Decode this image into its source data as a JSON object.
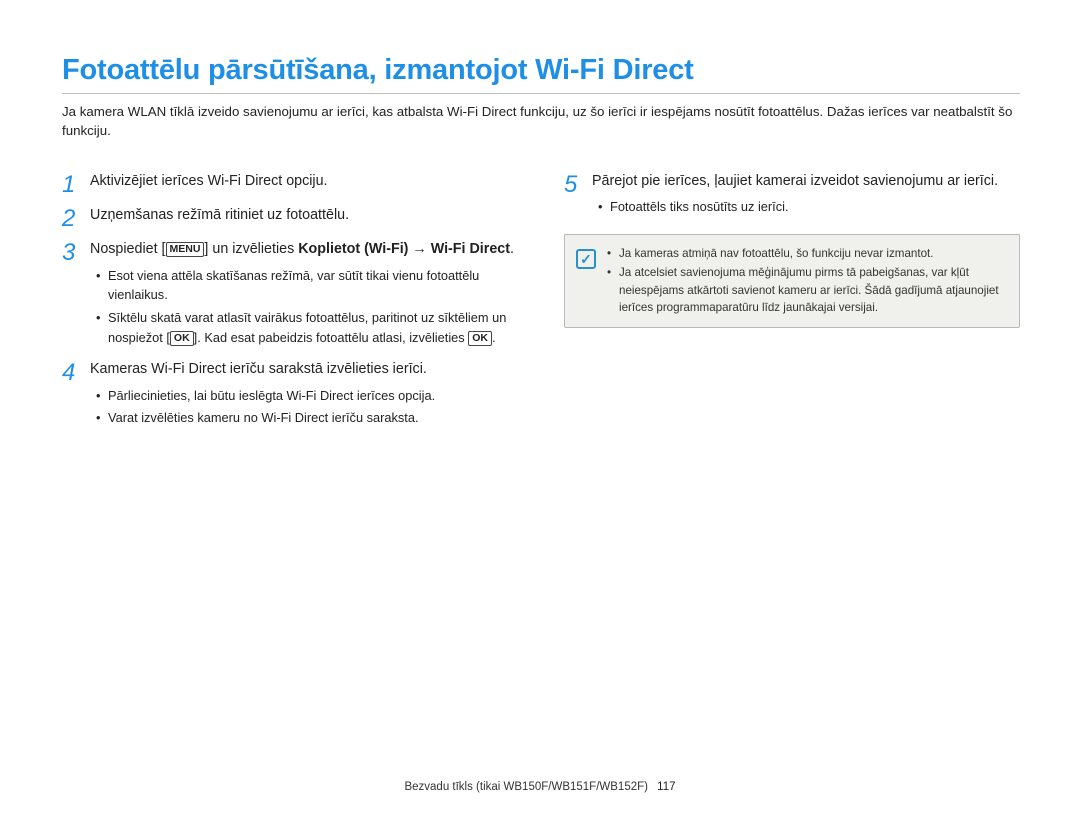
{
  "title": "Fotoattēlu pārsūtīšana, izmantojot Wi-Fi Direct",
  "intro": "Ja kamera WLAN tīklā izveido savienojumu ar ierīci, kas atbalsta Wi-Fi Direct funkciju, uz šo ierīci ir iespējams nosūtīt fotoattēlus. Dažas ierīces var neatbalstīt šo funkciju.",
  "steps": {
    "s1": {
      "num": "1",
      "text": "Aktivizējiet ierīces Wi-Fi Direct opciju."
    },
    "s2": {
      "num": "2",
      "text": "Uzņemšanas režīmā ritiniet uz fotoattēlu."
    },
    "s3": {
      "num": "3",
      "pre": "Nospiediet [",
      "menu": "MENU",
      "mid": "] un izvēlieties ",
      "bold1": "Koplietot (Wi-Fi)",
      "arrow": " → ",
      "bold2": "Wi-Fi Direct",
      "post": ".",
      "b1a": "Esot viena attēla skatīšanas režīmā, var sūtīt tikai vienu fotoattēlu vienlaikus.",
      "b2a": "Sīktēlu skatā varat atlasīt vairākus fotoattēlus, paritinot uz sīktēliem un nospiežot [",
      "b2ok": "OK",
      "b2b": "]. Kad esat pabeidzis fotoattēlu atlasi, izvēlieties ",
      "b2ok2": "OK",
      "b2c": "."
    },
    "s4": {
      "num": "4",
      "text": "Kameras Wi-Fi Direct ierīču sarakstā izvēlieties ierīci.",
      "b1": "Pārliecinieties, lai būtu ieslēgta Wi-Fi Direct ierīces opcija.",
      "b2": "Varat izvēlēties kameru no Wi-Fi Direct ierīču saraksta."
    },
    "s5": {
      "num": "5",
      "text": "Pārejot pie ierīces, ļaujiet kamerai izveidot savienojumu ar ierīci.",
      "b1": "Fotoattēls tiks nosūtīts uz ierīci."
    }
  },
  "note": {
    "n1": "Ja kameras atmiņā nav fotoattēlu, šo funkciju nevar izmantot.",
    "n2": "Ja atcelsiet savienojuma mēģinājumu pirms tā pabeigšanas, var kļūt neiespējams atkārtoti savienot kameru ar ierīci. Šādā gadījumā atjaunojiet ierīces programmaparatūru līdz jaunākajai versijai."
  },
  "footer": {
    "text": "Bezvadu tīkls (tikai WB150F/WB151F/WB152F)",
    "page": "117"
  }
}
